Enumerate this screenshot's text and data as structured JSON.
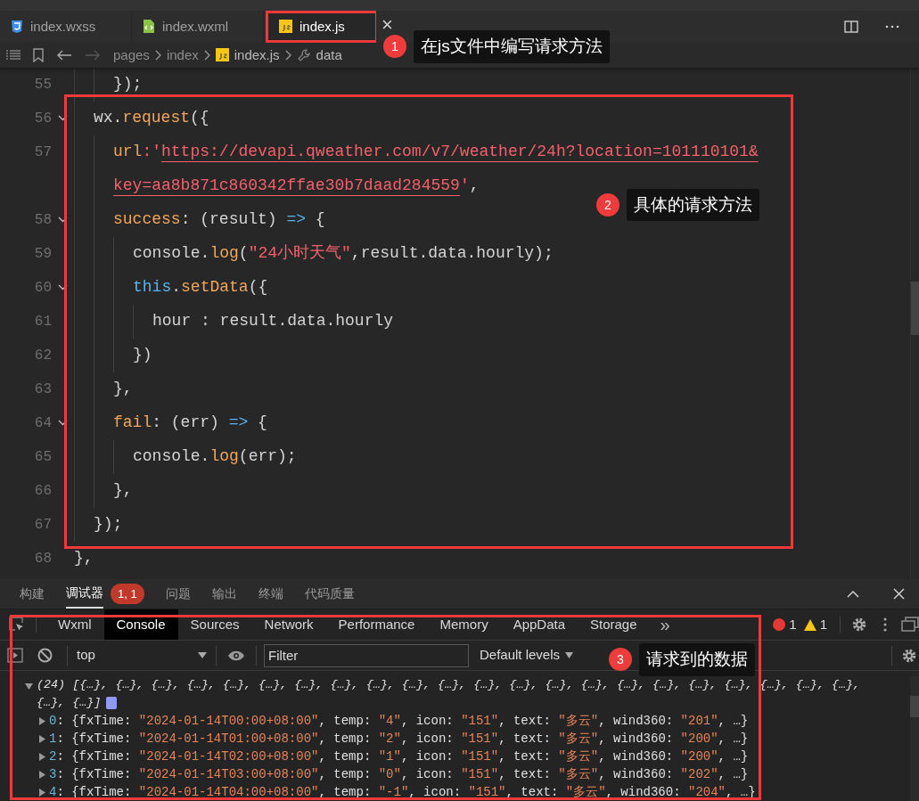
{
  "editor_tabs": [
    {
      "label": "index.wxss",
      "kind": "css",
      "selected": false
    },
    {
      "label": "index.wxml",
      "kind": "wxml",
      "selected": false
    },
    {
      "label": "index.js",
      "kind": "js",
      "selected": true
    }
  ],
  "close_symbol": "×",
  "breadcrumb": [
    {
      "label": "pages",
      "kind": "folder"
    },
    {
      "label": "index",
      "kind": "folder"
    },
    {
      "label": "index.js",
      "kind": "js"
    },
    {
      "label": "data",
      "kind": "wrench"
    }
  ],
  "code_lines": [
    {
      "children": [
        {
          "children": [
            {
              "num": "55",
              "fold": false,
              "tokens": [
                {
                  "t": "});",
                  "kind": "plain"
                }
              ]
            }
          ]
        },
        {
          "num": "56",
          "fold": true,
          "tokens": [
            {
              "t": "wx.",
              "kind": "plain"
            },
            {
              "t": "request",
              "kind": "fn"
            },
            {
              "t": "({",
              "kind": "plain"
            }
          ],
          "children": [
            {
              "num": "57",
              "fold": false,
              "tokens": [
                {
                  "t": "url",
                  "kind": "fn"
                },
                {
                  "t": ":'",
                  "kind": "string"
                },
                {
                  "t": "https://devapi.qweather.com/v7/weather/24h?location=101110101&",
                  "kind": "link"
                }
              ]
            },
            {
              "fold": false,
              "tokens": [
                {
                  "t": "key=aa8b871c860342ffae30b7daad284559",
                  "kind": "link"
                },
                {
                  "t": "'",
                  "kind": "string"
                },
                {
                  "t": ",",
                  "kind": "plain"
                }
              ]
            },
            {
              "num": "58",
              "fold": true,
              "tokens": [
                {
                  "t": "success",
                  "kind": "fn"
                },
                {
                  "t": ": (result) ",
                  "kind": "plain"
                },
                {
                  "t": "=>",
                  "kind": "kw"
                },
                {
                  "t": " {",
                  "kind": "plain"
                }
              ],
              "children": [
                {
                  "num": "59",
                  "fold": false,
                  "tokens": [
                    {
                      "t": "console.",
                      "kind": "plain"
                    },
                    {
                      "t": "log",
                      "kind": "fn"
                    },
                    {
                      "t": "(",
                      "kind": "plain"
                    },
                    {
                      "t": "\"24小时天气\"",
                      "kind": "string"
                    },
                    {
                      "t": ",result.data.hourly);",
                      "kind": "plain"
                    }
                  ]
                },
                {
                  "num": "60",
                  "fold": true,
                  "tokens": [
                    {
                      "t": "this",
                      "kind": "kw"
                    },
                    {
                      "t": ".",
                      "kind": "plain"
                    },
                    {
                      "t": "setData",
                      "kind": "fn"
                    },
                    {
                      "t": "({",
                      "kind": "plain"
                    }
                  ],
                  "children": [
                    {
                      "num": "61",
                      "fold": false,
                      "tokens": [
                        {
                          "t": "hour : result.data.hourly",
                          "kind": "plain"
                        }
                      ]
                    }
                  ]
                },
                {
                  "num": "62",
                  "fold": false,
                  "tokens": [
                    {
                      "t": "})",
                      "kind": "plain"
                    }
                  ]
                }
              ]
            },
            {
              "num": "63",
              "fold": false,
              "tokens": [
                {
                  "t": "},",
                  "kind": "plain"
                }
              ]
            },
            {
              "num": "64",
              "fold": true,
              "tokens": [
                {
                  "t": "fail",
                  "kind": "fn"
                },
                {
                  "t": ": (err) ",
                  "kind": "plain"
                },
                {
                  "t": "=>",
                  "kind": "kw"
                },
                {
                  "t": " {",
                  "kind": "plain"
                }
              ],
              "children": [
                {
                  "num": "65",
                  "fold": false,
                  "tokens": [
                    {
                      "t": "console.",
                      "kind": "plain"
                    },
                    {
                      "t": "log",
                      "kind": "fn"
                    },
                    {
                      "t": "(err);",
                      "kind": "plain"
                    }
                  ]
                }
              ]
            },
            {
              "num": "66",
              "fold": false,
              "tokens": [
                {
                  "t": "},",
                  "kind": "plain"
                }
              ]
            }
          ]
        },
        {
          "num": "67",
          "fold": false,
          "tokens": [
            {
              "t": "});",
              "kind": "plain"
            }
          ]
        }
      ]
    },
    {
      "num": "68",
      "fold": false,
      "tokens": [
        {
          "t": "},",
          "kind": "plain"
        }
      ]
    }
  ],
  "annotations": [
    {
      "number": "1",
      "text": "在js文件中编写请求方法"
    },
    {
      "number": "2",
      "text": "具体的请求方法"
    },
    {
      "number": "3",
      "text": "请求到的数据"
    }
  ],
  "panel_tabs": [
    {
      "label": "构建",
      "selected": false
    },
    {
      "label": "调试器",
      "selected": true,
      "badge": "1, 1"
    },
    {
      "label": "问题",
      "selected": false
    },
    {
      "label": "输出",
      "selected": false
    },
    {
      "label": "终端",
      "selected": false
    },
    {
      "label": "代码质量",
      "selected": false
    }
  ],
  "devtools_tabs": [
    {
      "label": "Wxml",
      "selected": false
    },
    {
      "label": "Console",
      "selected": true
    },
    {
      "label": "Sources",
      "selected": false
    },
    {
      "label": "Network",
      "selected": false
    },
    {
      "label": "Performance",
      "selected": false
    },
    {
      "label": "Memory",
      "selected": false
    },
    {
      "label": "AppData",
      "selected": false
    },
    {
      "label": "Storage",
      "selected": false
    }
  ],
  "more_tabs": "»",
  "errors": "1",
  "warnings": "1",
  "console_toolbar": {
    "context": "top",
    "filter_placeholder": "Filter",
    "levels": "Default levels"
  },
  "console_output": {
    "summary_1": "(24) [{…}, {…}, {…}, {…}, {…}, {…}, {…}, {…}, {…}, {…}, {…}, {…}, {…}, {…}, {…}, {…}, {…}, {…}, {…}, {…}, {…}, {…},",
    "summary_2": "{…}, {…}]",
    "rows": [
      {
        "index": "0",
        "tokens": [
          {
            "t": ": {fxTime: ",
            "kind": "plain"
          },
          {
            "t": "\"2024-01-14T00:00+08:00\"",
            "kind": "string"
          },
          {
            "t": ", temp: ",
            "kind": "plain"
          },
          {
            "t": "\"4\"",
            "kind": "string"
          },
          {
            "t": ", icon: ",
            "kind": "plain"
          },
          {
            "t": "\"151\"",
            "kind": "string"
          },
          {
            "t": ", text: ",
            "kind": "plain"
          },
          {
            "t": "\"多云\"",
            "kind": "string"
          },
          {
            "t": ", wind360: ",
            "kind": "plain"
          },
          {
            "t": "\"201\"",
            "kind": "string"
          },
          {
            "t": ", …}",
            "kind": "plain"
          }
        ]
      },
      {
        "index": "1",
        "tokens": [
          {
            "t": ": {fxTime: ",
            "kind": "plain"
          },
          {
            "t": "\"2024-01-14T01:00+08:00\"",
            "kind": "string"
          },
          {
            "t": ", temp: ",
            "kind": "plain"
          },
          {
            "t": "\"2\"",
            "kind": "string"
          },
          {
            "t": ", icon: ",
            "kind": "plain"
          },
          {
            "t": "\"151\"",
            "kind": "string"
          },
          {
            "t": ", text: ",
            "kind": "plain"
          },
          {
            "t": "\"多云\"",
            "kind": "string"
          },
          {
            "t": ", wind360: ",
            "kind": "plain"
          },
          {
            "t": "\"200\"",
            "kind": "string"
          },
          {
            "t": ", …}",
            "kind": "plain"
          }
        ]
      },
      {
        "index": "2",
        "tokens": [
          {
            "t": ": {fxTime: ",
            "kind": "plain"
          },
          {
            "t": "\"2024-01-14T02:00+08:00\"",
            "kind": "string"
          },
          {
            "t": ", temp: ",
            "kind": "plain"
          },
          {
            "t": "\"1\"",
            "kind": "string"
          },
          {
            "t": ", icon: ",
            "kind": "plain"
          },
          {
            "t": "\"151\"",
            "kind": "string"
          },
          {
            "t": ", text: ",
            "kind": "plain"
          },
          {
            "t": "\"多云\"",
            "kind": "string"
          },
          {
            "t": ", wind360: ",
            "kind": "plain"
          },
          {
            "t": "\"200\"",
            "kind": "string"
          },
          {
            "t": ", …}",
            "kind": "plain"
          }
        ]
      },
      {
        "index": "3",
        "tokens": [
          {
            "t": ": {fxTime: ",
            "kind": "plain"
          },
          {
            "t": "\"2024-01-14T03:00+08:00\"",
            "kind": "string"
          },
          {
            "t": ", temp: ",
            "kind": "plain"
          },
          {
            "t": "\"0\"",
            "kind": "string"
          },
          {
            "t": ", icon: ",
            "kind": "plain"
          },
          {
            "t": "\"151\"",
            "kind": "string"
          },
          {
            "t": ", text: ",
            "kind": "plain"
          },
          {
            "t": "\"多云\"",
            "kind": "string"
          },
          {
            "t": ", wind360: ",
            "kind": "plain"
          },
          {
            "t": "\"202\"",
            "kind": "string"
          },
          {
            "t": ", …}",
            "kind": "plain"
          }
        ]
      },
      {
        "index": "4",
        "tokens": [
          {
            "t": ": {fxTime: ",
            "kind": "plain"
          },
          {
            "t": "\"2024-01-14T04:00+08:00\"",
            "kind": "string"
          },
          {
            "t": ", temp: ",
            "kind": "plain"
          },
          {
            "t": "\"-1\"",
            "kind": "string"
          },
          {
            "t": ", icon: ",
            "kind": "plain"
          },
          {
            "t": "\"151\"",
            "kind": "string"
          },
          {
            "t": ", text: ",
            "kind": "plain"
          },
          {
            "t": "\"多云\"",
            "kind": "string"
          },
          {
            "t": ", wind360: ",
            "kind": "plain"
          },
          {
            "t": "\"204\"",
            "kind": "string"
          },
          {
            "t": ", …}",
            "kind": "plain"
          }
        ]
      }
    ]
  }
}
